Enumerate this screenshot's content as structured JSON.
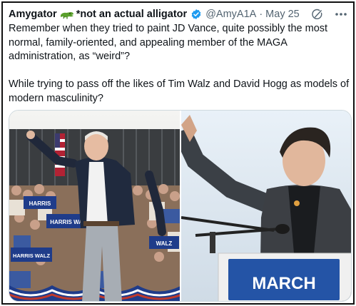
{
  "tweet": {
    "display_name": "Amygator",
    "display_name_suffix": "*not an actual alligator",
    "handle": "@AmyA1A",
    "separator": "·",
    "date": "May 25",
    "paragraphs": [
      "Remember when they tried to paint JD Vance, quite possibly the most normal, family-oriented, and appealing member of the MAGA administration, as “weird”?",
      "While trying to pass off the likes of Tim Walz and David Hogg as models of modern masculinity?"
    ]
  },
  "icons": {
    "name_emoji": "crocodile-icon",
    "verified": "verified-badge-icon",
    "grok": "grok-icon",
    "more": "more-options-icon"
  },
  "media": {
    "left_photo_signs": [
      "HARRIS",
      "WALZ",
      "HARRIS WALZ",
      "HARRIS WALZ"
    ],
    "right_photo_podium_text": "MARCH"
  },
  "colors": {
    "verified_blue": "#1d9bf0",
    "muted_text": "#536471",
    "sign_blue": "#1f3c8a",
    "podium_blue": "#2454a6"
  }
}
